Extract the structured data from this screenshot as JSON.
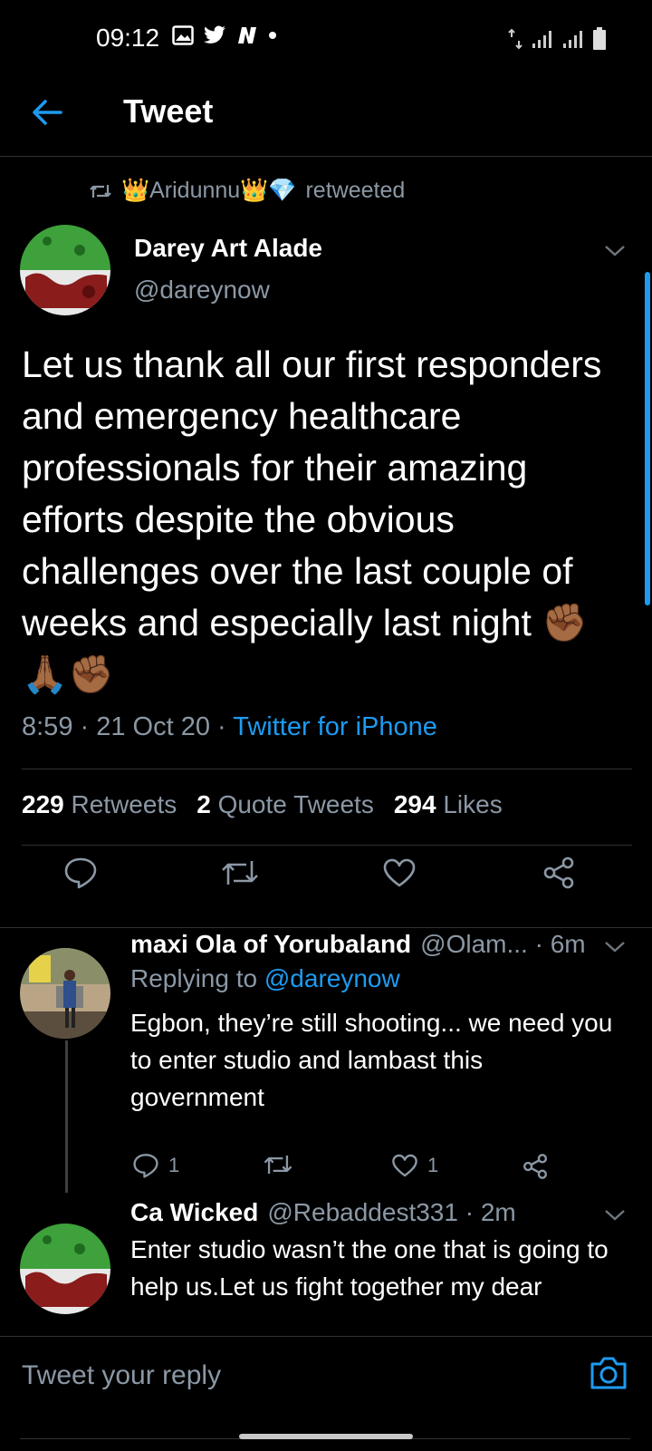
{
  "status": {
    "time": "09:12",
    "icons": [
      "image-icon",
      "twitter-bird-icon",
      "n-icon",
      "dot-icon"
    ],
    "right_icons": [
      "data-arrows-icon",
      "signal-icon",
      "signal-icon",
      "battery-icon"
    ]
  },
  "header": {
    "title": "Tweet"
  },
  "retweet": {
    "user": "👑Aridunnu👑💎",
    "suffix": "retweeted"
  },
  "tweet": {
    "name": "Darey Art Alade",
    "handle": "@dareynow",
    "text": "Let us thank all our first responders and emergency healthcare professionals for their amazing efforts despite the obvious challenges over the last couple of weeks and especially last night ✊🏾🙏🏾✊🏾",
    "time": "8:59 · 21 Oct 20 · ",
    "source": "Twitter for iPhone",
    "stats": {
      "retweets_count": "229",
      "retweets_label": "Retweets",
      "quotes_count": "2",
      "quotes_label": "Quote Tweets",
      "likes_count": "294",
      "likes_label": "Likes"
    }
  },
  "replies": [
    {
      "name": "maxi Ola of Yorubaland",
      "handle_time": "@Olam... · 6m",
      "replying_prefix": "Replying to ",
      "replying_to": "@dareynow",
      "text": "Egbon, they’re still shooting... we need you to enter studio and lambast this government",
      "reply_count": "1",
      "like_count": "1"
    },
    {
      "name": "Ca Wicked",
      "handle_time": "@Rebaddest331 · 2m",
      "text": "Enter studio wasn’t the one that is going to help us.Let us fight together my dear"
    }
  ],
  "compose": {
    "placeholder": "Tweet your reply"
  },
  "colors": {
    "accent": "#1d9bf0",
    "background": "#000000",
    "muted": "#8b98a5"
  }
}
